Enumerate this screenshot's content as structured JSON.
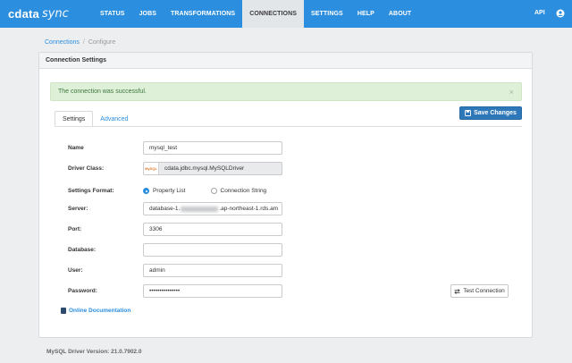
{
  "app": {
    "logo_mark": "cdata",
    "logo_sub": "sync"
  },
  "nav": {
    "items": [
      {
        "label": "STATUS"
      },
      {
        "label": "JOBS"
      },
      {
        "label": "TRANSFORMATIONS"
      },
      {
        "label": "CONNECTIONS",
        "active": true
      },
      {
        "label": "SETTINGS"
      },
      {
        "label": "HELP"
      },
      {
        "label": "ABOUT"
      }
    ],
    "api_label": "API",
    "user_icon": "user-circle-icon"
  },
  "breadcrumb": {
    "link": "Connections",
    "separator": "/",
    "current": "Configure"
  },
  "panel": {
    "title": "Connection Settings",
    "alert_text": "The connection was successful.",
    "alert_close": "×",
    "save_label": "Save Changes",
    "tabs": [
      {
        "label": "Settings",
        "active": true
      },
      {
        "label": "Advanced"
      }
    ]
  },
  "form": {
    "name_label": "Name",
    "name_value": "mysql_test",
    "driver_label": "Driver Class:",
    "driver_value": "cdata.jdbc.mysql.MySQLDriver",
    "format_label": "Settings Format:",
    "format_options": [
      "Property List",
      "Connection String"
    ],
    "format_selected": "Property List",
    "server_label": "Server:",
    "server_prefix": "database-1.",
    "server_suffix": ".ap-northeast-1.rds.am",
    "port_label": "Port:",
    "port_value": "3306",
    "database_label": "Database:",
    "database_value": "",
    "user_label": "User:",
    "user_value": "admin",
    "password_label": "Password:",
    "password_value": "•••••••••••••••",
    "test_label": "Test Connection",
    "docs_label": "Online Documentation"
  },
  "footer": {
    "version": "MySQL Driver Version: 21.0.7902.0"
  },
  "colors": {
    "brand": "#2b8ede",
    "save_button": "#2e77b8",
    "success_bg": "#dff0d8",
    "success_text": "#3c763d"
  }
}
